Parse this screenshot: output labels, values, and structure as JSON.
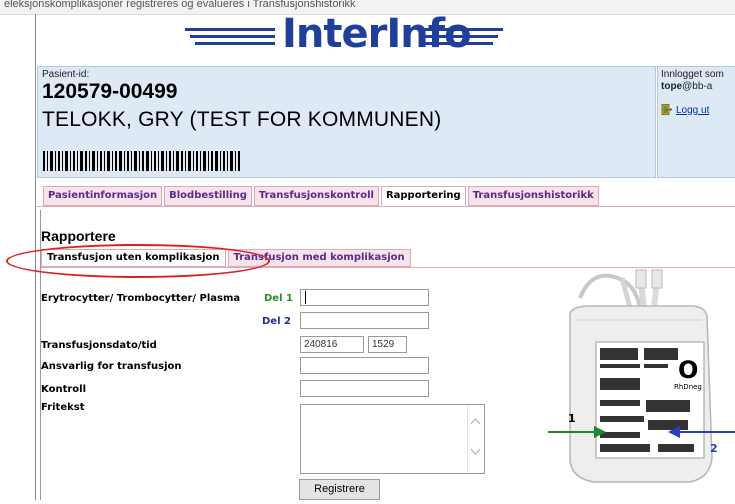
{
  "top_strip_text": "eleksjonskomplikasjoner registreres og evalueres i Transfusjonshistorikk",
  "app": {
    "logo_text": "InterInfo"
  },
  "patient": {
    "id_label": "Pasient-id:",
    "id": "120579-00499",
    "name": "TELOKK, GRY (TEST FOR KOMMUNEN)"
  },
  "login": {
    "line1": "Innlogget som",
    "user_prefix": "tope",
    "user_domain": "@bb-a",
    "logout": "Logg ut"
  },
  "tabs": [
    {
      "label": "Pasientinformasjon",
      "active": false
    },
    {
      "label": "Blodbestilling",
      "active": false
    },
    {
      "label": "Transfusjonskontroll",
      "active": false
    },
    {
      "label": "Rapportering",
      "active": true
    },
    {
      "label": "Transfusjonshistorikk",
      "active": false
    }
  ],
  "section": {
    "title": "Rapportere",
    "subtabs": [
      {
        "label": "Transfusjon uten komplikasjon",
        "active": true
      },
      {
        "label": "Transfusjon med komplikasjon",
        "active": false
      }
    ]
  },
  "form": {
    "product_label": "Erytrocytter/ Trombocytter/ Plasma",
    "del1": "Del 1",
    "del2": "Del 2",
    "del1_value": "",
    "del2_value": "",
    "date_label": "Transfusjonsdato/tid",
    "date_value": "240816",
    "time_value": "1529",
    "responsible_label": "Ansvarlig for transfusjon",
    "responsible_value": "",
    "control_label": "Kontroll",
    "control_value": "",
    "free_text_label": "Fritekst",
    "free_text_value": "",
    "submit": "Registrere"
  },
  "image": {
    "blood_group": "O",
    "rhd": "RhDneg",
    "marker1": "1",
    "marker2": "2",
    "colors": {
      "marker1": "#1e8a2a",
      "marker2": "#2a3fc0"
    }
  },
  "colors": {
    "brand": "#1f3f9a",
    "panel": "#dde9f5",
    "tab_bg": "#f7e3ea",
    "tab_text": "#5a2a8c",
    "highlight_ellipse": "#e02020"
  }
}
